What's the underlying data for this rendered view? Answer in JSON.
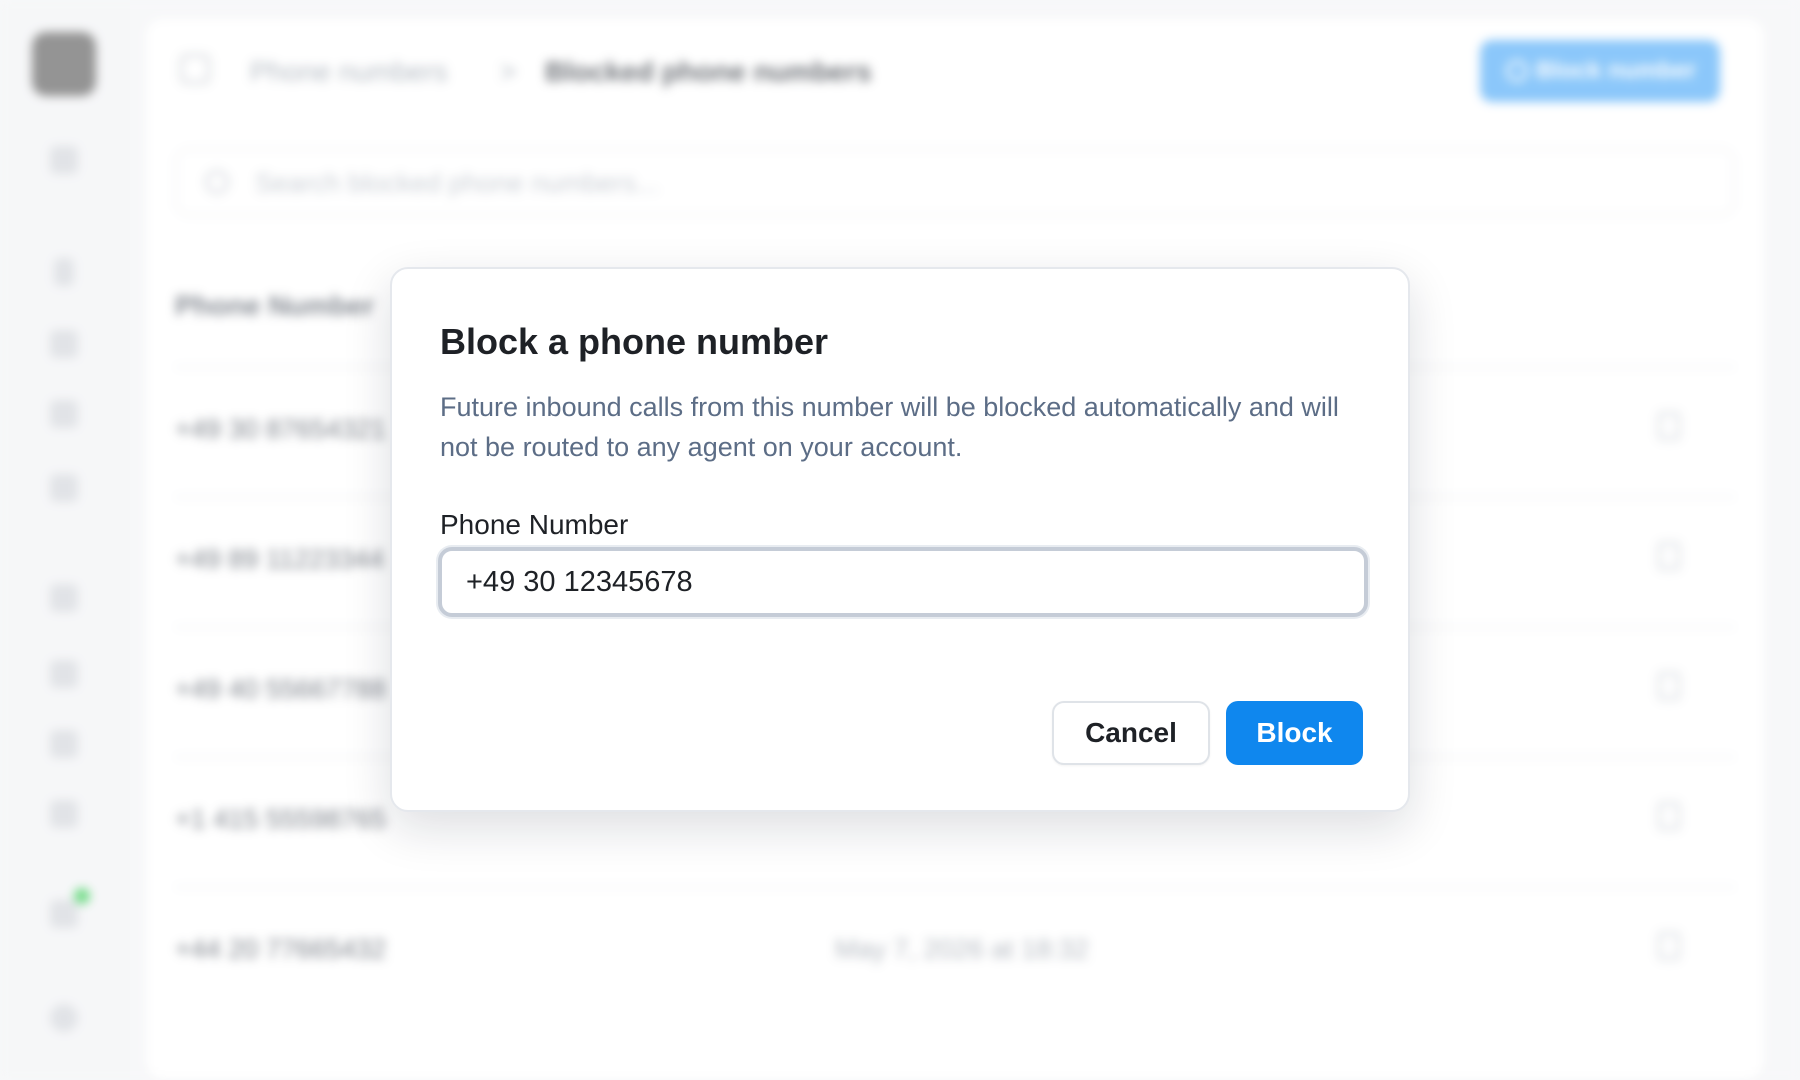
{
  "background": {
    "breadcrumb": {
      "parent": "Phone numbers",
      "separator": ">",
      "current": "Blocked phone numbers"
    },
    "primary_action": "Block number",
    "search": {
      "placeholder": "Search blocked phone numbers..."
    },
    "table": {
      "header": "Phone Number",
      "rows": [
        {
          "number": "+49 30 87654321",
          "date": ""
        },
        {
          "number": "+49 89 11223344",
          "date": ""
        },
        {
          "number": "+49 40 55667788",
          "date": ""
        },
        {
          "number": "+1 415 55598765",
          "date": ""
        },
        {
          "number": "+44 20 77665432",
          "date": "May 7, 2026 at 18:32"
        }
      ]
    }
  },
  "dialog": {
    "title": "Block a phone number",
    "description": "Future inbound calls from this number will be blocked automatically and will not be routed to any agent on your account.",
    "field_label": "Phone Number",
    "field_value": "+49 30 12345678",
    "cancel_label": "Cancel",
    "confirm_label": "Block",
    "colors": {
      "confirm": "#0f87ee",
      "description": "#5c6d86"
    }
  }
}
